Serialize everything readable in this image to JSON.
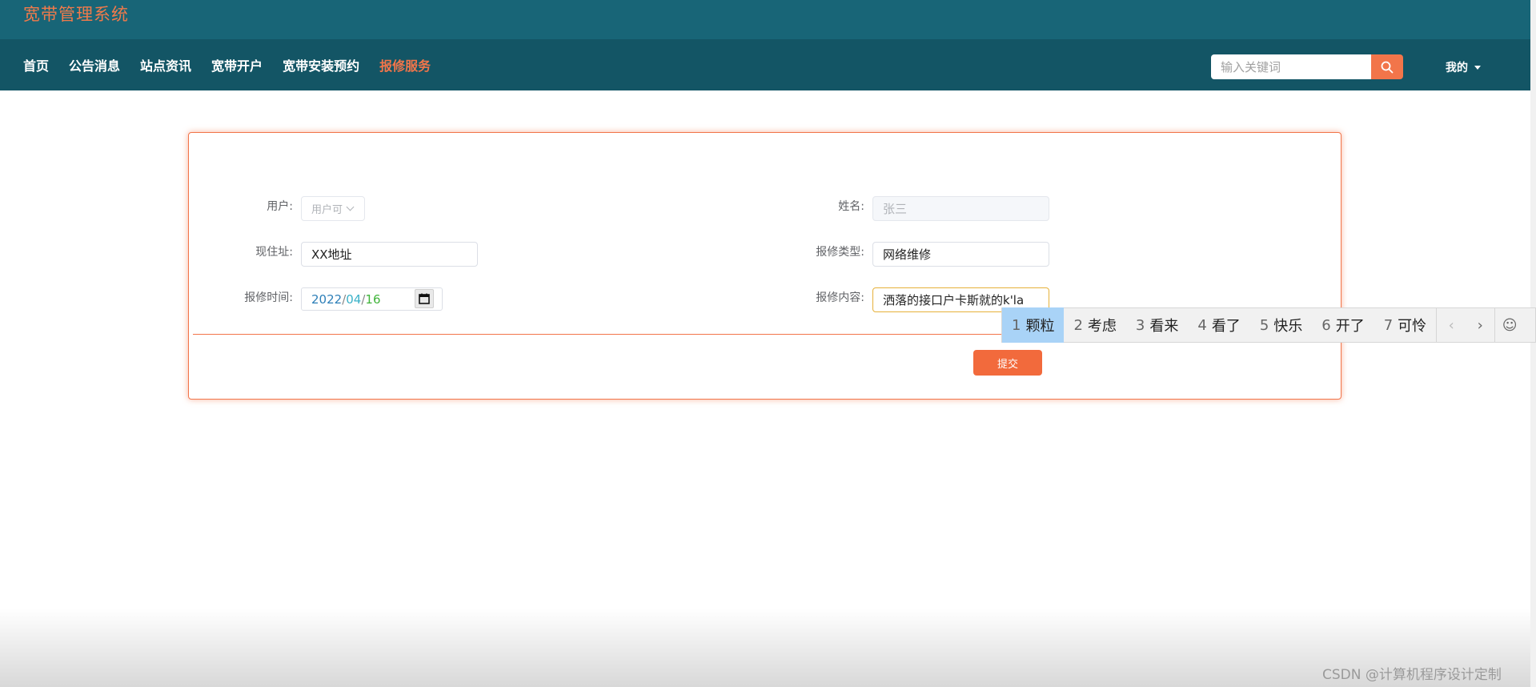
{
  "header": {
    "app_title": "宽带管理系统",
    "nav": [
      {
        "label": "首页",
        "active": false
      },
      {
        "label": "公告消息",
        "active": false
      },
      {
        "label": "站点资讯",
        "active": false
      },
      {
        "label": "宽带开户",
        "active": false
      },
      {
        "label": "宽带安装预约",
        "active": false
      },
      {
        "label": "报修服务",
        "active": true
      }
    ],
    "search": {
      "placeholder": "输入关键词",
      "icon": "search-icon"
    },
    "user_menu": {
      "label": "我的",
      "icon": "caret-down-icon"
    }
  },
  "form": {
    "user": {
      "label": "用户:",
      "value": "用户可"
    },
    "name": {
      "label": "姓名:",
      "value": "张三"
    },
    "address": {
      "label": "现住址:",
      "value": "XX地址"
    },
    "repair_type": {
      "label": "报修类型:",
      "value": "网络维修"
    },
    "repair_time": {
      "label": "报修时间:",
      "year": "2022",
      "month": "04",
      "day": "16",
      "sep": "/"
    },
    "repair_content": {
      "label": "报修内容:",
      "value": "洒落的接口户卡斯就的k'la"
    },
    "submit_label": "提交"
  },
  "ime": {
    "candidates": [
      {
        "num": "1",
        "text": "颗粒",
        "selected": true
      },
      {
        "num": "2",
        "text": "考虑",
        "selected": false
      },
      {
        "num": "3",
        "text": "看来",
        "selected": false
      },
      {
        "num": "4",
        "text": "看了",
        "selected": false
      },
      {
        "num": "5",
        "text": "快乐",
        "selected": false
      },
      {
        "num": "6",
        "text": "开了",
        "selected": false
      },
      {
        "num": "7",
        "text": "可怜",
        "selected": false
      }
    ],
    "prev": "‹",
    "next": "›",
    "emoji": "☺"
  },
  "watermark": "CSDN @计算机程序设计定制",
  "colors": {
    "topbar": "#186577",
    "navbar": "#135565",
    "accent": "#f2754a",
    "ime_selected": "#a9d3f7"
  }
}
